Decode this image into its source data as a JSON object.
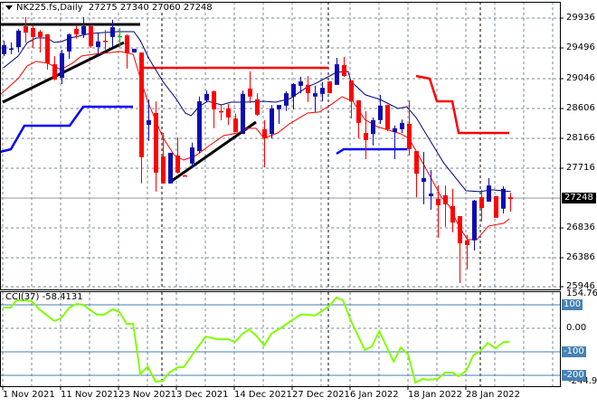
{
  "header": {
    "symbol": "NK225.fs,Daily",
    "ohlc": "27275 27340 27060 27248"
  },
  "price_axis": [
    "29936",
    "29496",
    "29046",
    "28606",
    "28166",
    "27716",
    "26836",
    "26386",
    "25946"
  ],
  "current_price": "27248",
  "cci": {
    "label": "CCI(37)",
    "value": "-58.4131",
    "max": "154.7623",
    "min": "-244.983",
    "zero": "0.00",
    "lvl_100": "100",
    "lvl_m100": "-100",
    "lvl_m200": "-200"
  },
  "dates": [
    "1 Nov 2021",
    "11 Nov 2021",
    "23 Nov 2021",
    "3 Dec 2021",
    "14 Dec 2021",
    "27 Dec 2021",
    "6 Jan 2022",
    "18 Jan 2022",
    "28 Jan 2022"
  ],
  "colors": {
    "bull": "#0c0cb4",
    "bear": "#ff0000",
    "ma_slow": "#000080",
    "ma_fast": "#ff0000",
    "cci": "#80ff00",
    "level": "#4682b4"
  },
  "chart_data": {
    "type": "candlestick",
    "title": "NK225.fs,Daily",
    "ylim": [
      25946,
      29936
    ],
    "cci_ylim": [
      -244.983,
      154.7623
    ],
    "candles": [
      [
        29400,
        29600,
        29370,
        29535
      ],
      [
        29480,
        29575,
        29400,
        29485
      ],
      [
        29505,
        29775,
        29425,
        29750
      ],
      [
        29815,
        29950,
        29575,
        29720
      ],
      [
        29790,
        29830,
        29495,
        29655
      ],
      [
        29735,
        29760,
        29425,
        29655
      ],
      [
        29695,
        29700,
        29170,
        29265
      ],
      [
        29250,
        29370,
        29010,
        29025
      ],
      [
        29050,
        29465,
        28955,
        29415
      ],
      [
        29440,
        29710,
        29330,
        29695
      ],
      [
        29775,
        29830,
        29630,
        29695
      ],
      [
        29695,
        29950,
        29640,
        29815
      ],
      [
        29815,
        29830,
        29495,
        29520
      ],
      [
        29505,
        29710,
        29370,
        29590
      ],
      [
        29600,
        29760,
        29465,
        29595
      ],
      [
        29655,
        29910,
        29505,
        29800
      ],
      [
        29670,
        29790,
        29505,
        29670
      ],
      [
        29680,
        29695,
        29185,
        29415
      ],
      [
        29425,
        29480,
        29425,
        29480
      ],
      [
        29425,
        29425,
        27480,
        27870
      ],
      [
        28350,
        28730,
        28110,
        28420
      ],
      [
        28525,
        28700,
        27360,
        27640
      ],
      [
        27880,
        28230,
        27480,
        27480
      ],
      [
        27480,
        27935,
        27480,
        27935
      ],
      [
        27895,
        28165,
        27625,
        27640
      ],
      [
        27600,
        27610,
        27590,
        27600
      ],
      [
        27775,
        28085,
        27705,
        28015
      ],
      [
        27960,
        28770,
        27935,
        28700
      ],
      [
        28715,
        28860,
        28700,
        28810
      ],
      [
        28850,
        28860,
        28300,
        28580
      ],
      [
        28555,
        28660,
        28420,
        28550
      ],
      [
        28595,
        28660,
        28350,
        28460
      ],
      [
        28445,
        28515,
        28245,
        28245
      ],
      [
        28215,
        28860,
        28215,
        28810
      ],
      [
        28890,
        29145,
        28675,
        28770
      ],
      [
        28730,
        28820,
        28485,
        28500
      ],
      [
        28285,
        28420,
        27720,
        28150
      ],
      [
        28215,
        28645,
        28150,
        28595
      ],
      [
        28580,
        28645,
        28365,
        28645
      ],
      [
        28635,
        28850,
        28555,
        28820
      ],
      [
        28770,
        28970,
        28580,
        28955
      ],
      [
        28930,
        29065,
        28820,
        28995
      ],
      [
        28945,
        29075,
        28690,
        28820
      ],
      [
        28770,
        28930,
        28540,
        28820
      ],
      [
        28810,
        28985,
        28700,
        28900
      ],
      [
        28995,
        29000,
        28820,
        28820
      ],
      [
        28945,
        29345,
        28945,
        29250
      ],
      [
        29240,
        29360,
        29065,
        29075
      ],
      [
        29010,
        29010,
        28445,
        28700
      ],
      [
        28715,
        28715,
        28150,
        28380
      ],
      [
        28230,
        28555,
        27840,
        28125
      ],
      [
        28215,
        28460,
        28045,
        28420
      ],
      [
        28420,
        28795,
        28365,
        28635
      ],
      [
        28645,
        28650,
        28255,
        28285
      ],
      [
        28245,
        28340,
        27840,
        28300
      ],
      [
        28285,
        28430,
        28230,
        28380
      ],
      [
        28365,
        28715,
        27895,
        27990
      ],
      [
        27960,
        27960,
        27275,
        27625
      ],
      [
        27505,
        27950,
        27170,
        27560
      ],
      [
        27290,
        27680,
        27090,
        27330
      ],
      [
        27250,
        27450,
        26675,
        27155
      ],
      [
        27305,
        27450,
        26835,
        27170
      ],
      [
        27145,
        27400,
        26755,
        26900
      ],
      [
        26995,
        26995,
        26000,
        26590
      ],
      [
        26635,
        26715,
        26205,
        26565
      ],
      [
        26635,
        27235,
        26485,
        27225
      ],
      [
        27275,
        27385,
        26915,
        27115
      ],
      [
        27210,
        27560,
        27210,
        27450
      ],
      [
        27290,
        27295,
        26970,
        26970
      ],
      [
        27105,
        27440,
        27035,
        27400
      ],
      [
        27275,
        27340,
        27060,
        27248
      ]
    ],
    "ma_slow": [
      [
        0,
        29198
      ],
      [
        2,
        29372
      ],
      [
        3.3,
        29574
      ],
      [
        4.5,
        29641
      ],
      [
        6,
        29641
      ],
      [
        7,
        29574
      ],
      [
        8,
        29587
      ],
      [
        9.25,
        29641
      ],
      [
        12,
        29708
      ],
      [
        15.7,
        29735
      ],
      [
        18,
        29735
      ],
      [
        18.9,
        29601
      ],
      [
        20.1,
        29332
      ],
      [
        22,
        28996
      ],
      [
        23.9,
        28728
      ],
      [
        25.1,
        28526
      ],
      [
        25.9,
        28486
      ],
      [
        27,
        28620
      ],
      [
        28.2,
        28701
      ],
      [
        30.1,
        28647
      ],
      [
        31.4,
        28687
      ],
      [
        33.25,
        28687
      ],
      [
        36,
        28700
      ],
      [
        37.6,
        28687
      ],
      [
        39.6,
        28741
      ],
      [
        42,
        28916
      ],
      [
        43.2,
        28970
      ],
      [
        46,
        29131
      ],
      [
        47.6,
        29144
      ],
      [
        48,
        28996
      ],
      [
        50,
        28795
      ],
      [
        52,
        28728
      ],
      [
        54.5,
        28593
      ],
      [
        55.7,
        28620
      ],
      [
        57,
        28459
      ],
      [
        59.5,
        28016
      ],
      [
        60.8,
        27788
      ],
      [
        63.9,
        27371
      ],
      [
        65.75,
        27358
      ],
      [
        67.6,
        27385
      ],
      [
        70.1,
        27358
      ]
    ],
    "ma_fast": [
      [
        -0.5,
        28795
      ],
      [
        2,
        29037
      ],
      [
        3.25,
        29225
      ],
      [
        4.5,
        29292
      ],
      [
        6.1,
        29265
      ],
      [
        7.9,
        29171
      ],
      [
        9.5,
        29265
      ],
      [
        10.75,
        29372
      ],
      [
        12.4,
        29399
      ],
      [
        14.9,
        29426
      ],
      [
        16.1,
        29440
      ],
      [
        17.9,
        29399
      ],
      [
        19.1,
        28970
      ],
      [
        19.9,
        28701
      ],
      [
        22,
        28164
      ],
      [
        23.6,
        27895
      ],
      [
        24.9,
        27828
      ],
      [
        26.6,
        27895
      ],
      [
        28.25,
        28029
      ],
      [
        30.4,
        28190
      ],
      [
        32.4,
        28231
      ],
      [
        33.6,
        28298
      ],
      [
        34.9,
        28298
      ],
      [
        36,
        28150
      ],
      [
        37.9,
        28231
      ],
      [
        39.5,
        28365
      ],
      [
        42,
        28526
      ],
      [
        43.6,
        28540
      ],
      [
        45.4,
        28661
      ],
      [
        46.75,
        28768
      ],
      [
        48.25,
        28701
      ],
      [
        49.9,
        28432
      ],
      [
        51.6,
        28325
      ],
      [
        53.6,
        28258
      ],
      [
        54.9,
        28217
      ],
      [
        56,
        28150
      ],
      [
        57,
        27962
      ],
      [
        58.6,
        27653
      ],
      [
        60.4,
        27291
      ],
      [
        61.6,
        27143
      ],
      [
        62.9,
        26848
      ],
      [
        64.1,
        26646
      ],
      [
        65.4,
        26646
      ],
      [
        67,
        26848
      ],
      [
        69.1,
        26888
      ],
      [
        69.9,
        26955
      ]
    ],
    "cci": [
      [
        -0.1,
        88
      ],
      [
        1,
        88
      ],
      [
        1.75,
        119
      ],
      [
        3,
        119
      ],
      [
        3.9,
        115
      ],
      [
        4.9,
        81
      ],
      [
        7,
        31
      ],
      [
        7.9,
        42
      ],
      [
        9.1,
        88
      ],
      [
        10.1,
        104
      ],
      [
        11,
        100
      ],
      [
        12,
        77
      ],
      [
        12.9,
        58
      ],
      [
        13.9,
        58
      ],
      [
        15.1,
        81
      ],
      [
        16,
        69
      ],
      [
        17,
        19
      ],
      [
        17.9,
        19
      ],
      [
        18.9,
        -196
      ],
      [
        19.9,
        -162
      ],
      [
        21,
        -227
      ],
      [
        22,
        -223
      ],
      [
        22.9,
        -188
      ],
      [
        24.1,
        -165
      ],
      [
        24.9,
        -165
      ],
      [
        26.1,
        -112
      ],
      [
        27.9,
        -35
      ],
      [
        29.5,
        -46
      ],
      [
        31,
        -46
      ],
      [
        32,
        -58
      ],
      [
        32.9,
        -27
      ],
      [
        33.9,
        -4
      ],
      [
        34.9,
        -31
      ],
      [
        36,
        -73
      ],
      [
        37,
        -23
      ],
      [
        38.25,
        0
      ],
      [
        39.5,
        27
      ],
      [
        41,
        58
      ],
      [
        42,
        58
      ],
      [
        43,
        54
      ],
      [
        43.6,
        65
      ],
      [
        44.9,
        92
      ],
      [
        46,
        131
      ],
      [
        46.9,
        119
      ],
      [
        48,
        31
      ],
      [
        49.9,
        -92
      ],
      [
        50.9,
        -77
      ],
      [
        51.9,
        -12
      ],
      [
        53.9,
        -142
      ],
      [
        54.9,
        -81
      ],
      [
        55.9,
        -112
      ],
      [
        56.9,
        -231
      ],
      [
        57.9,
        -215
      ],
      [
        58.6,
        -219
      ],
      [
        60,
        -215
      ],
      [
        61,
        -188
      ],
      [
        62,
        -188
      ],
      [
        62.9,
        -204
      ],
      [
        63.9,
        -181
      ],
      [
        64.9,
        -115
      ],
      [
        65.75,
        -100
      ],
      [
        66.9,
        -62
      ],
      [
        68,
        -85
      ],
      [
        69.1,
        -58
      ],
      [
        69.9,
        -58.4131
      ]
    ],
    "cci_levels": [
      100,
      0,
      -100,
      -200
    ]
  }
}
